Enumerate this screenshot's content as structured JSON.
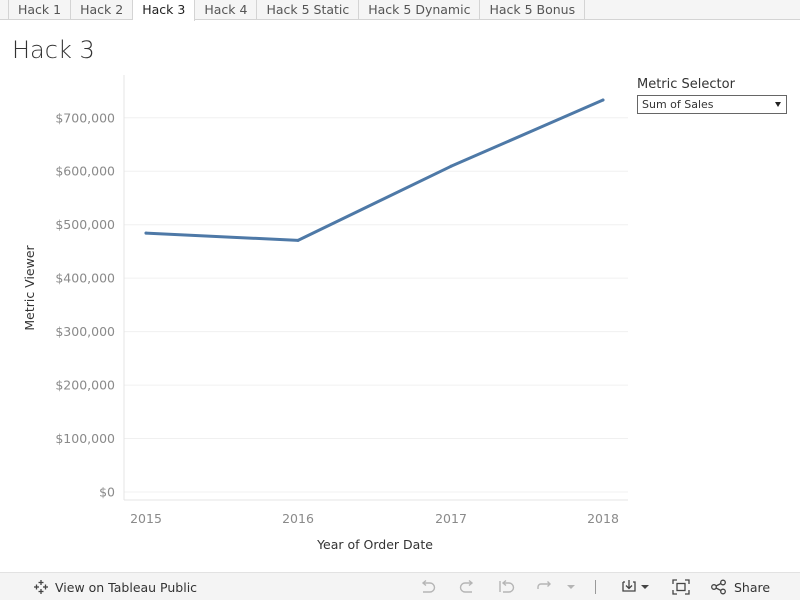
{
  "tabs": [
    {
      "label": "Hack 1",
      "active": false
    },
    {
      "label": "Hack 2",
      "active": false
    },
    {
      "label": "Hack 3",
      "active": true
    },
    {
      "label": "Hack 4",
      "active": false
    },
    {
      "label": "Hack 5 Static",
      "active": false
    },
    {
      "label": "Hack 5 Dynamic",
      "active": false
    },
    {
      "label": "Hack 5 Bonus",
      "active": false
    }
  ],
  "page_title": "Hack 3",
  "parameter": {
    "label": "Metric Selector",
    "selected": "Sum of Sales"
  },
  "toolbar": {
    "view_on_public": "View on Tableau Public",
    "share": "Share",
    "icons": [
      "tableau-logo-icon",
      "undo-icon",
      "redo-icon",
      "revert-icon",
      "refresh-icon",
      "dropdown-arrow-icon",
      "download-icon",
      "fullscreen-icon",
      "share-icon"
    ]
  },
  "chart_data": {
    "type": "line",
    "x": [
      "2015",
      "2016",
      "2017",
      "2018"
    ],
    "series": [
      {
        "values": [
          484247,
          470533,
          609206,
          733215
        ],
        "color": "#4e79a7"
      }
    ],
    "xlabel": "Year of Order Date",
    "ylabel": "Metric Viewer",
    "ylim": [
      0,
      780000
    ],
    "yticks": [
      0,
      100000,
      200000,
      300000,
      400000,
      500000,
      600000,
      700000
    ],
    "ytick_labels": [
      "$0",
      "$100,000",
      "$200,000",
      "$300,000",
      "$400,000",
      "$500,000",
      "$600,000",
      "$700,000"
    ],
    "grid": true
  }
}
